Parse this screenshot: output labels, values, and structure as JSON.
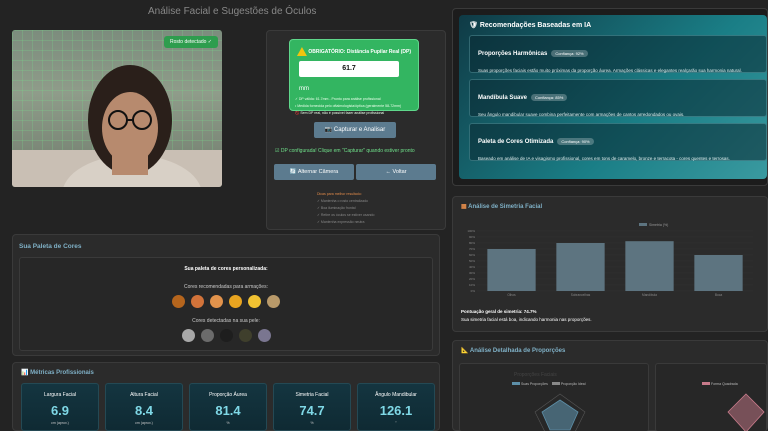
{
  "page": {
    "title": "Análise Facial e Sugestões de Óculos"
  },
  "camera": {
    "badge": "Rosto detectado ✓"
  },
  "dp": {
    "title": "OBRIGATÓRIO: Distância Pupilar Real (DP)",
    "value": "61.7",
    "unit": "mm",
    "note1": "✓ DP válida: 61.7mm - Pronto para análise profissional",
    "note2": "• Medida fornecida pelo oftalmologista/óptica (geralmente 58-72mm)",
    "note3": "🚫 Sem DP real, não é possível fazer análise profissional",
    "capture_button": "Capturar e Analisar",
    "status": "DP configurada! Clique em \"Capturar\" quando estiver pronto",
    "switch_camera_button": "Alternar Câmera",
    "back_button": "← Voltar",
    "tips": [
      "Dicas para melhor resultado:",
      "✓ Mantenha o rosto centralizado",
      "✓ Boa iluminação frontal",
      "✓ Retire os óculos se estiver usando",
      "✓ Mantenha expressão neutra"
    ]
  },
  "ai": {
    "heading": "Recomendações Baseadas em IA",
    "cards": [
      {
        "title": "Proporções Harmônicas",
        "confidence": "Confiança: 92%",
        "text": "Suas proporções faciais estão muito próximas da proporção áurea. Armações clássicas e elegantes realçarão sua harmonia natural."
      },
      {
        "title": "Mandíbula Suave",
        "confidence": "Confiança: 85%",
        "text": "Seu ângulo mandibular suave combina perfeitamente com armações de cantos arredondados ou ovais."
      },
      {
        "title": "Paleta de Cores Otimizada",
        "confidence": "Confiança: 90%",
        "text": "Baseado em análise de IA e visagismo profissional, cores em tons de caramelo, bronze e terracota - cores quentes e terrosas."
      }
    ]
  },
  "symmetry": {
    "title": "Análise de Simetria Facial",
    "legend": "Simetria (%)",
    "y_ticks": [
      "100%",
      "90%",
      "80%",
      "70%",
      "60%",
      "50%",
      "40%",
      "30%",
      "20%",
      "10%",
      "0%"
    ],
    "score_line": "Pontuação geral de simetria: 74.7%",
    "comment": "Sua simetria facial está boa, indicando harmonia nas proporções.",
    "bar_color": "#5d7480"
  },
  "chart_data": {
    "type": "bar",
    "categories": [
      "Olhos",
      "Sobrancelhas",
      "Mandíbula",
      "Boca"
    ],
    "series": [
      {
        "name": "Simetria (%)",
        "values": [
          70,
          80,
          83,
          60
        ]
      }
    ],
    "ylim": [
      0,
      100
    ],
    "ylabel": "",
    "xlabel": ""
  },
  "palette": {
    "title": "Sua Paleta de Cores",
    "subtitle": "Sua paleta de cores personalizada:",
    "frames_label": "Cores recomendadas para armações:",
    "frame_colors": [
      "#b5651d",
      "#d2733a",
      "#e2934c",
      "#e8a420",
      "#f1c232",
      "#b99a6a"
    ],
    "skin_label": "Cores detectadas na sua pele:",
    "skin_colors": [
      "#a8a8a8",
      "#6b6b6b",
      "#1e1e1e",
      "#3f3f2c",
      "#7a7690"
    ]
  },
  "metrics": {
    "title": "Métricas Profissionais",
    "items": [
      {
        "label": "Largura Facial",
        "value": "6.9",
        "unit": "cm (aprox.)"
      },
      {
        "label": "Altura Facial",
        "value": "8.4",
        "unit": "cm (aprox.)"
      },
      {
        "label": "Proporção Áurea",
        "value": "81.4",
        "unit": "%"
      },
      {
        "label": "Simetria Facial",
        "value": "74.7",
        "unit": "%"
      },
      {
        "label": "Ângulo Mandibular",
        "value": "126.1",
        "unit": "°"
      }
    ]
  },
  "proportion": {
    "title": "Análise Detalhada de Proporções",
    "left_chart_title": "Proporções Faciais",
    "left_legend": [
      "Suas Proporções",
      "Proporção Ideal"
    ],
    "right_legend": [
      "Forma Quadrada"
    ]
  }
}
